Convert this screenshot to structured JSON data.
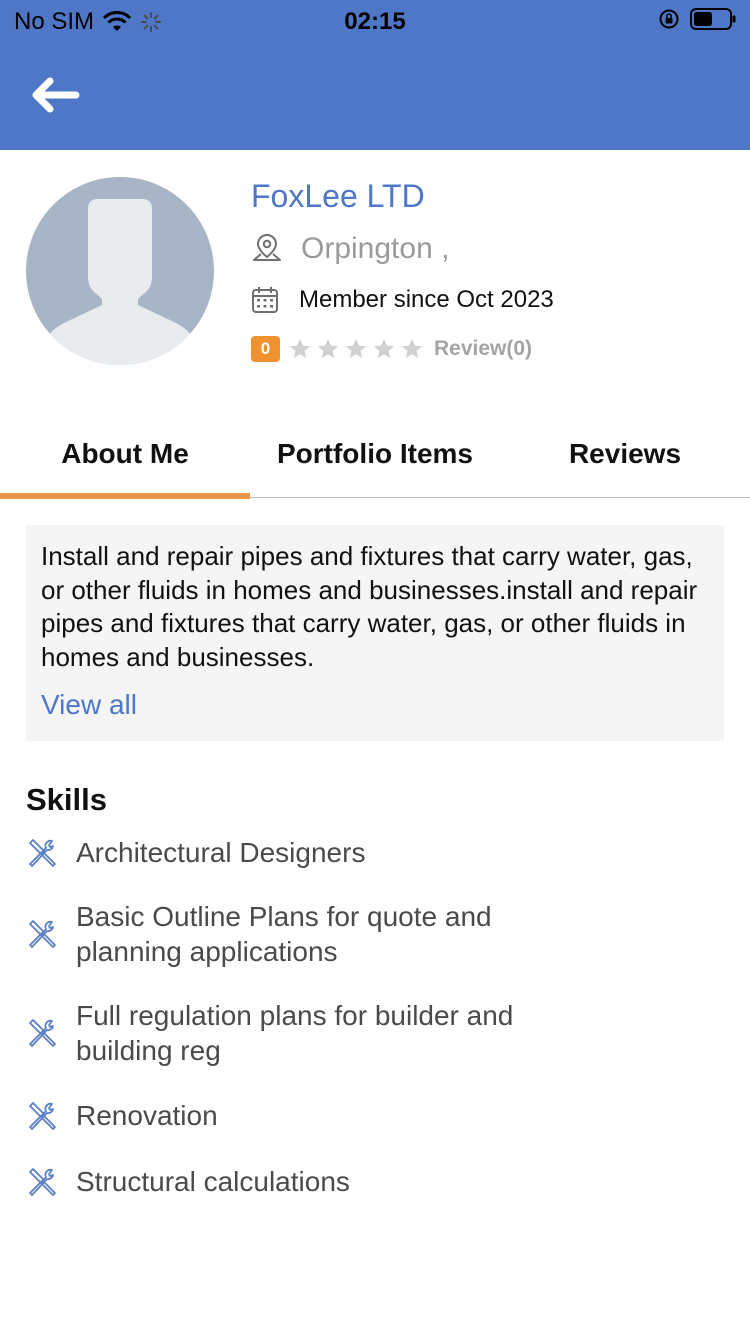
{
  "status_bar": {
    "carrier": "No SIM",
    "time": "02:15",
    "icons": [
      "wifi-icon",
      "activity-spinner-icon",
      "orientation-lock-icon",
      "battery-icon"
    ]
  },
  "header": {
    "background_color": "#4e77c8",
    "back_icon": "arrow-left-icon"
  },
  "profile": {
    "name": "FoxLee LTD",
    "location": "Orpington ,",
    "member_since": "Member since Oct 2023",
    "rating_badge": "0",
    "stars_filled": 0,
    "stars_total": 5,
    "review_label": "Review(0)",
    "accent_color": "#4e77c8",
    "badge_color": "#f0922e"
  },
  "tabs": [
    {
      "label": "About Me",
      "active": true
    },
    {
      "label": "Portfolio Items",
      "active": false
    },
    {
      "label": "Reviews",
      "active": false
    }
  ],
  "about": {
    "text": "Install and repair pipes and fixtures that carry water, gas, or other fluids in homes and businesses.install and repair pipes and fixtures that carry water, gas, or other fluids in homes and businesses.",
    "view_all": "View all"
  },
  "skills": {
    "title": "Skills",
    "items": [
      "Architectural Designers",
      "Basic Outline Plans for quote and planning applications",
      "Full regulation plans for builder and building reg",
      "Renovation",
      "Structural calculations"
    ]
  }
}
